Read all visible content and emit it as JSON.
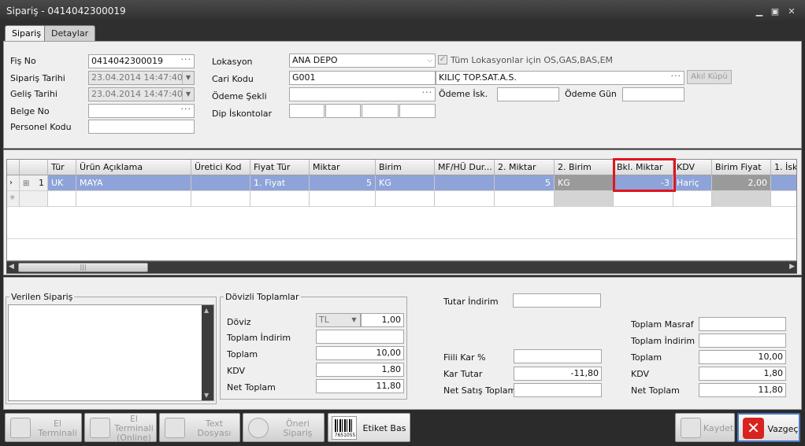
{
  "window": {
    "title": "Sipariş - 0414042300019"
  },
  "tabs": [
    "Sipariş",
    "Detaylar"
  ],
  "form": {
    "fis_no_label": "Fiş No",
    "fis_no": "0414042300019",
    "siparis_tarihi_label": "Sipariş Tarihi",
    "siparis_tarihi": "23.04.2014 14:47:40",
    "gelis_tarihi_label": "Geliş Tarihi",
    "gelis_tarihi": "23.04.2014 14:47:40",
    "belge_no_label": "Belge No",
    "belge_no": "",
    "personel_kodu_label": "Personel Kodu",
    "personel_kodu": "",
    "lokasyon_label": "Lokasyon",
    "lokasyon": "ANA DEPO",
    "tum_lokasyonlar_label": "Tüm Lokasyonlar için OS,GAS,BAS,EM",
    "cari_kodu_label": "Cari Kodu",
    "cari_kodu": "G001",
    "cari_adi": "KILIÇ TOP.SAT.A.S.",
    "akil_kupu_label": "Akıl Küpü",
    "odeme_sekli_label": "Ödeme Şekli",
    "odeme_sekli": "",
    "odeme_isk_label": "Ödeme İsk.",
    "odeme_isk": "",
    "odeme_gun_label": "Ödeme Gün",
    "odeme_gun": "",
    "dip_iskontolar_label": "Dip İskontolar"
  },
  "grid": {
    "columns": [
      "Tür",
      "Ürün Açıklama",
      "Üretici Kod",
      "Fiyat Tür",
      "Miktar",
      "Birim",
      "MF/HÜ Dur...",
      "2. Miktar",
      "2. Birim",
      "Bkl. Miktar",
      "KDV",
      "Birim Fiyat",
      "1. İsk"
    ],
    "rows": [
      {
        "no": "1",
        "tur": "UK",
        "urun": "MAYA",
        "uretici": "",
        "fiyat_tur": "1. Fiyat",
        "miktar": "5",
        "birim": "KG",
        "mfhu": "",
        "miktar2": "5",
        "birim2": "KG",
        "bkl_miktar": "-3",
        "kdv": "Hariç",
        "birim_fiyat": "2,00",
        "isk1": ""
      }
    ]
  },
  "verilen_siparis_label": "Verilen Sipariş",
  "dovizli": {
    "title": "Dövizli Toplamlar",
    "doviz_label": "Döviz",
    "doviz_currency": "TL",
    "doviz_rate": "1,00",
    "toplam_indirim_label": "Toplam İndirim",
    "toplam_indirim": "",
    "toplam_label": "Toplam",
    "toplam": "10,00",
    "kdv_label": "KDV",
    "kdv": "1,80",
    "net_toplam_label": "Net Toplam",
    "net_toplam": "11,80"
  },
  "middle": {
    "tutar_indirim_label": "Tutar İndirim",
    "tutar_indirim": "",
    "fiili_kar_label": "Fiili Kar %",
    "fiili_kar": "",
    "kar_tutar_label": "Kar Tutar",
    "kar_tutar": "-11,80",
    "net_satis_label": "Net Satış Toplam",
    "net_satis": ""
  },
  "right_totals": {
    "toplam_masraf_label": "Toplam Masraf",
    "toplam_masraf": "",
    "toplam_indirim_label": "Toplam İndirim",
    "toplam_indirim": "",
    "toplam_label": "Toplam",
    "toplam": "10,00",
    "kdv_label": "KDV",
    "kdv": "1,80",
    "net_toplam_label": "Net Toplam",
    "net_toplam": "11,80"
  },
  "footer_buttons": {
    "el_terminali": "El Terminali",
    "el_terminali_online_1": "El Terminali",
    "el_terminali_online_2": "(Online)",
    "text_dosyasi": "Text Dosyası",
    "oneri_siparis": "Öneri Sipariş",
    "etiket_bas": "Etiket Bas",
    "barcode_digits": "7651055",
    "kaydet": "Kaydet",
    "vazgec": "Vazgeç"
  },
  "colors": {
    "highlight": "#e0141e",
    "selected_row": "#8ea3d8",
    "title_bar": "#3a3a3a"
  }
}
